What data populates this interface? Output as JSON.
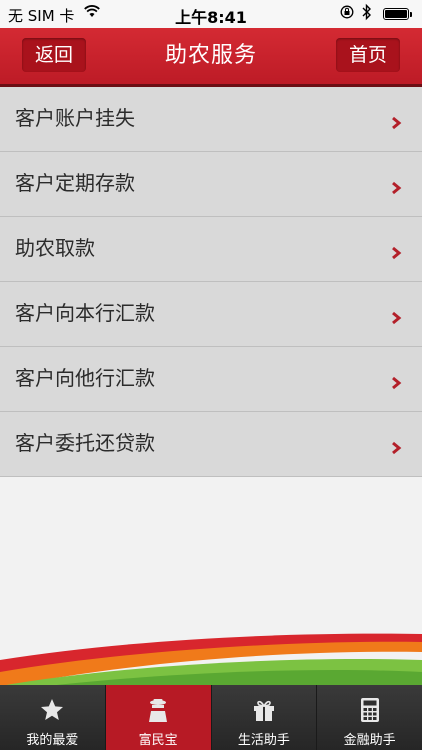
{
  "status_bar": {
    "carrier": "无 SIM 卡",
    "time": "上午8:41",
    "icons": [
      "wifi-icon",
      "orientation-lock-icon",
      "bluetooth-icon",
      "battery-icon"
    ]
  },
  "nav": {
    "back_label": "返回",
    "title": "助农服务",
    "home_label": "首页"
  },
  "menu": {
    "items": [
      {
        "label": "客户账户挂失"
      },
      {
        "label": "客户定期存款"
      },
      {
        "label": "助农取款"
      },
      {
        "label": "客户向本行汇款"
      },
      {
        "label": "客户向他行汇款"
      },
      {
        "label": "客户委托还贷款"
      }
    ]
  },
  "tabs": [
    {
      "label": "我的最爱",
      "icon": "star-icon",
      "active": false
    },
    {
      "label": "富民宝",
      "icon": "person-icon",
      "active": true
    },
    {
      "label": "生活助手",
      "icon": "gift-icon",
      "active": false
    },
    {
      "label": "金融助手",
      "icon": "calculator-icon",
      "active": false
    }
  ],
  "colors": {
    "brand_red": "#c3202b",
    "active_tab": "#b71a25",
    "chevron": "#b3202a",
    "tab_bar": "#2e2e2e",
    "swoosh_orange": "#f07a1a",
    "swoosh_green": "#7cc242"
  }
}
